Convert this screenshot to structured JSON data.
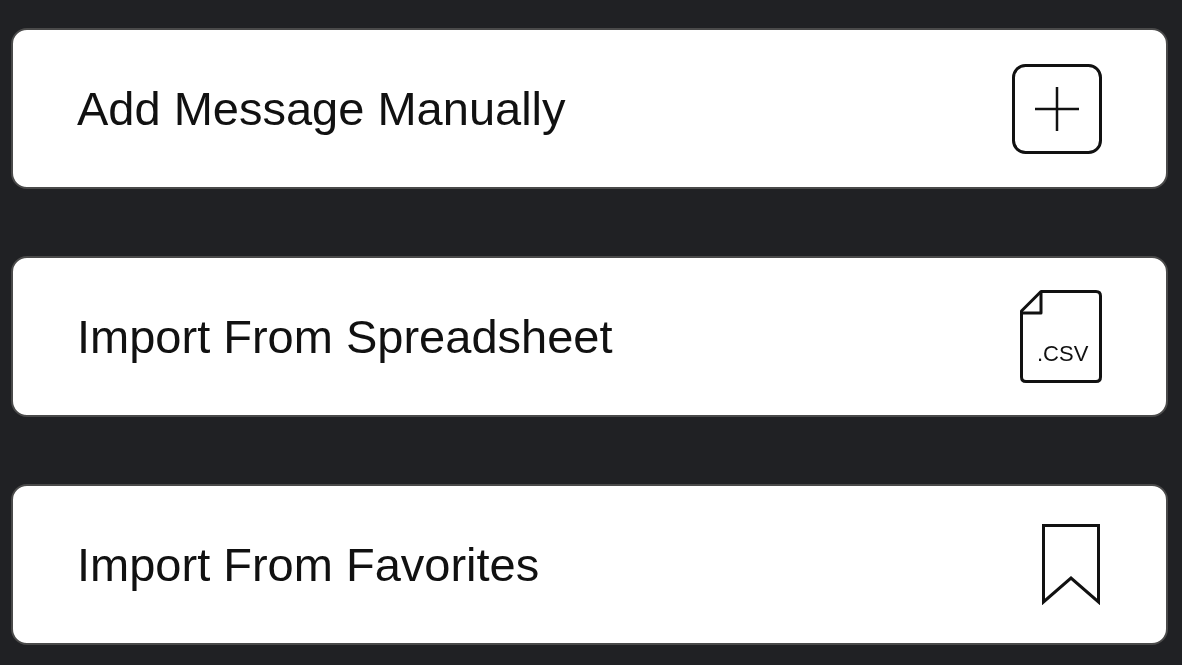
{
  "options": [
    {
      "kind": "plus",
      "label": "Add Message Manually"
    },
    {
      "kind": "file",
      "label": "Import From Spreadsheet",
      "icon_text": ".CSV"
    },
    {
      "kind": "bookmark",
      "label": "Import From Favorites"
    }
  ]
}
